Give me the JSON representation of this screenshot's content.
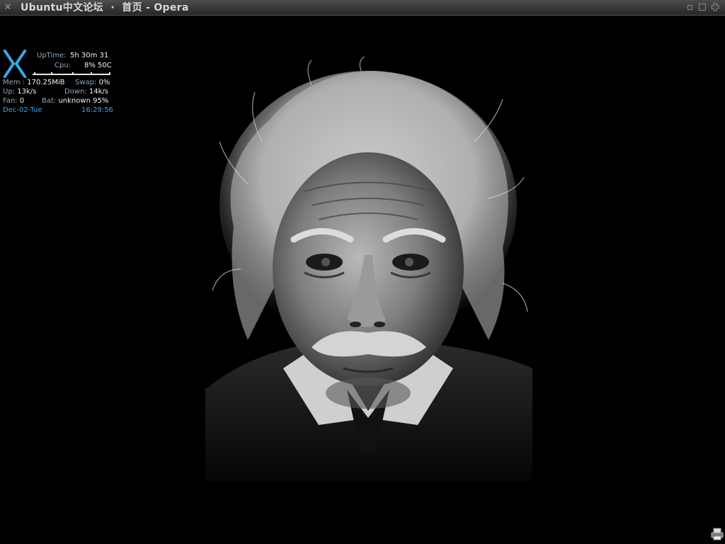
{
  "window": {
    "title": "Ubuntu中文论坛  ·  首页 - Opera",
    "buttons": [
      "minimize",
      "maximize",
      "close"
    ]
  },
  "conky": {
    "logo_letter": "X",
    "uptime_label": "UpTime:",
    "uptime_value": "5h 30m 31",
    "cpu_label": "Cpu:",
    "cpu_value": "8% 50C",
    "mem_label": "Mem :",
    "mem_value": "170.25MiB",
    "swap_label": "Swap:",
    "swap_value": "0%",
    "up_label": "Up:",
    "up_value": "13k/s",
    "down_label": "Down:",
    "down_value": "14k/s",
    "fan_label": "Fan:",
    "fan_value": "0",
    "bat_label": "Bat:",
    "bat_value": "unknown 95%",
    "date": "Dec-02-Tue",
    "time": "16:29:56"
  },
  "desktop": {
    "wallpaper": "black-and-white portrait photograph",
    "tray_icon": "printer-icon"
  },
  "colors": {
    "background": "#000000",
    "accent": "#3aa6e8",
    "label": "#8fa7bf",
    "value": "#f2f2f2"
  }
}
